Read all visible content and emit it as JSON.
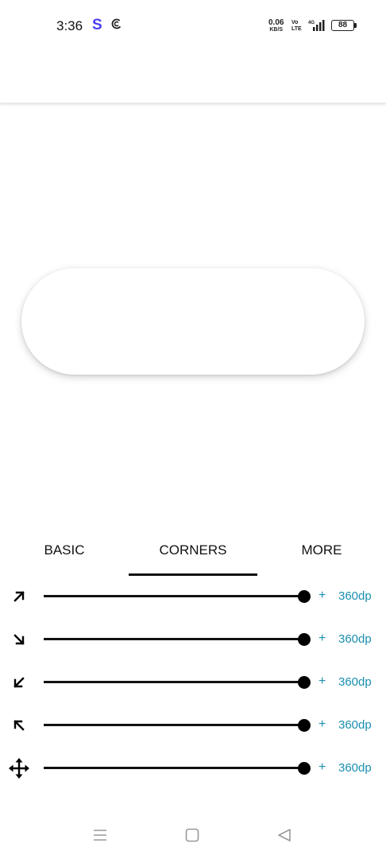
{
  "status_bar": {
    "time": "3:36",
    "app_icon_1": "S",
    "net_speed": "0.06",
    "net_speed_unit": "KB/S",
    "volte_top": "Vo",
    "volte_bottom": "LTE",
    "network": "4G",
    "battery": "88",
    "colors": {
      "app_icon_1": "#4b3df0"
    }
  },
  "tabs": [
    {
      "label": "BASIC",
      "selected": false
    },
    {
      "label": "CORNERS",
      "selected": true
    },
    {
      "label": "MORE",
      "selected": false
    }
  ],
  "rows": [
    {
      "icon": "arrow-up-right-icon",
      "plus": "+",
      "value": "360dp",
      "slider_fraction": 1.0
    },
    {
      "icon": "arrow-down-right-icon",
      "plus": "+",
      "value": "360dp",
      "slider_fraction": 1.0
    },
    {
      "icon": "arrow-down-left-icon",
      "plus": "+",
      "value": "360dp",
      "slider_fraction": 1.0
    },
    {
      "icon": "arrow-up-left-icon",
      "plus": "+",
      "value": "360dp",
      "slider_fraction": 1.0
    },
    {
      "icon": "move-all-icon",
      "plus": "+",
      "value": "360dp",
      "slider_fraction": 1.0
    }
  ],
  "nav": {
    "recents": "menu-icon",
    "home": "home-square-icon",
    "back": "back-triangle-icon"
  },
  "accent_color": "#1a8fb0"
}
